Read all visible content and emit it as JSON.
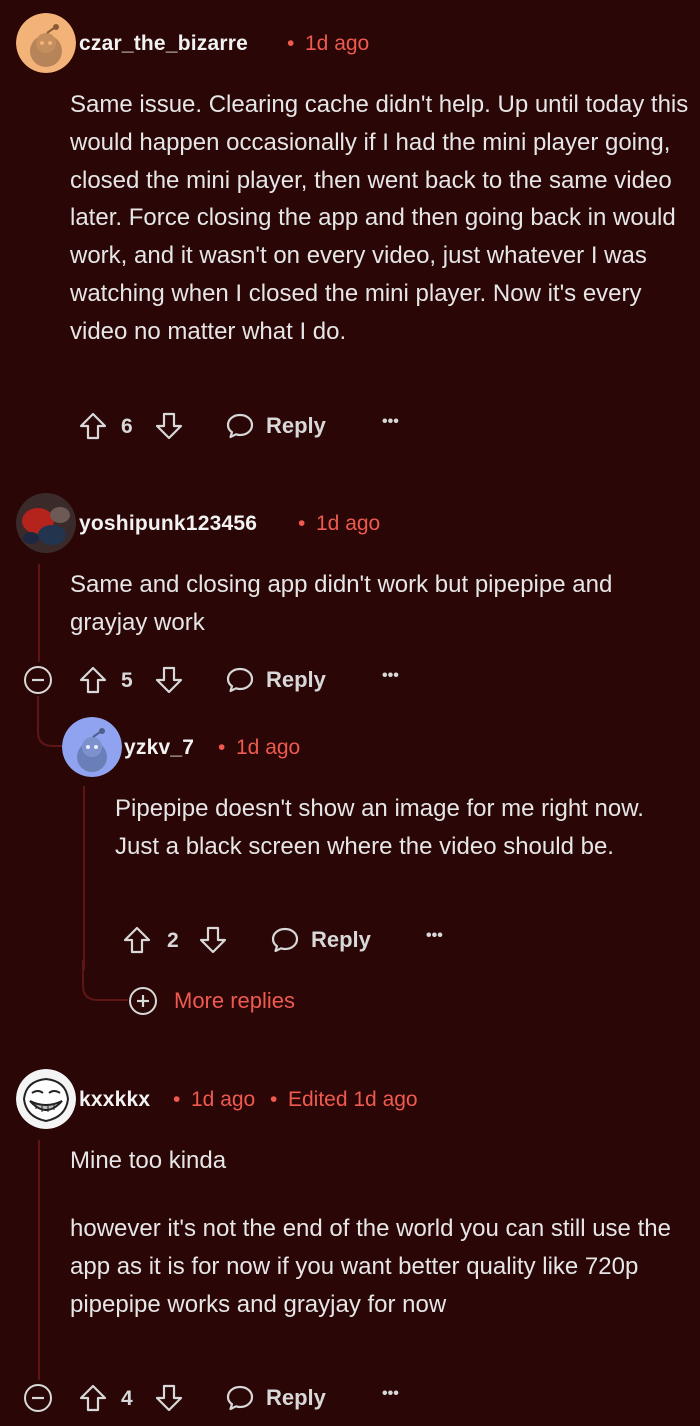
{
  "colors": {
    "background": "#2a0606",
    "accent": "#ee5a4f",
    "thread_line": "#5e1515",
    "text": "#e6e6e6"
  },
  "comments": [
    {
      "username": "czar_the_bizarre",
      "time": "1d ago",
      "avatar": "snoo-avatar-orange",
      "body": "Same issue. Clearing cache didn't help. Up until today this would happen occasionally if I had the mini player going, closed the mini player, then went back to the same video later. Force closing the app and then going back in would work, and it wasn't on every video, just whatever I was watching when I closed the mini player. Now it's every video no matter what I do.",
      "votes": "6",
      "reply_label": "Reply",
      "more_label": "•••"
    },
    {
      "username": "yoshipunk123456",
      "time": "1d ago",
      "avatar": "photo-avatar",
      "body": "Same and closing app didn't work but pipepipe and grayjay work",
      "votes": "5",
      "reply_label": "Reply",
      "more_label": "•••"
    },
    {
      "username": "yzkv_7",
      "time": "1d ago",
      "avatar": "snoo-avatar-blue",
      "body": "Pipepipe doesn't show an image for me right now. Just a black screen where the video should be.",
      "votes": "2",
      "reply_label": "Reply",
      "more_label": "•••"
    },
    {
      "username": "kxxkkx",
      "time": "1d ago",
      "edited": "Edited 1d ago",
      "avatar": "trollface-avatar",
      "body_p1": "Mine too kinda",
      "body_p2": "however it's not the end of the world you can still use the app as it is for now if you want better quality like 720p pipepipe works and grayjay for now",
      "votes": "4",
      "reply_label": "Reply",
      "more_label": "•••"
    }
  ],
  "more_replies_label": "More replies",
  "separator": "•"
}
